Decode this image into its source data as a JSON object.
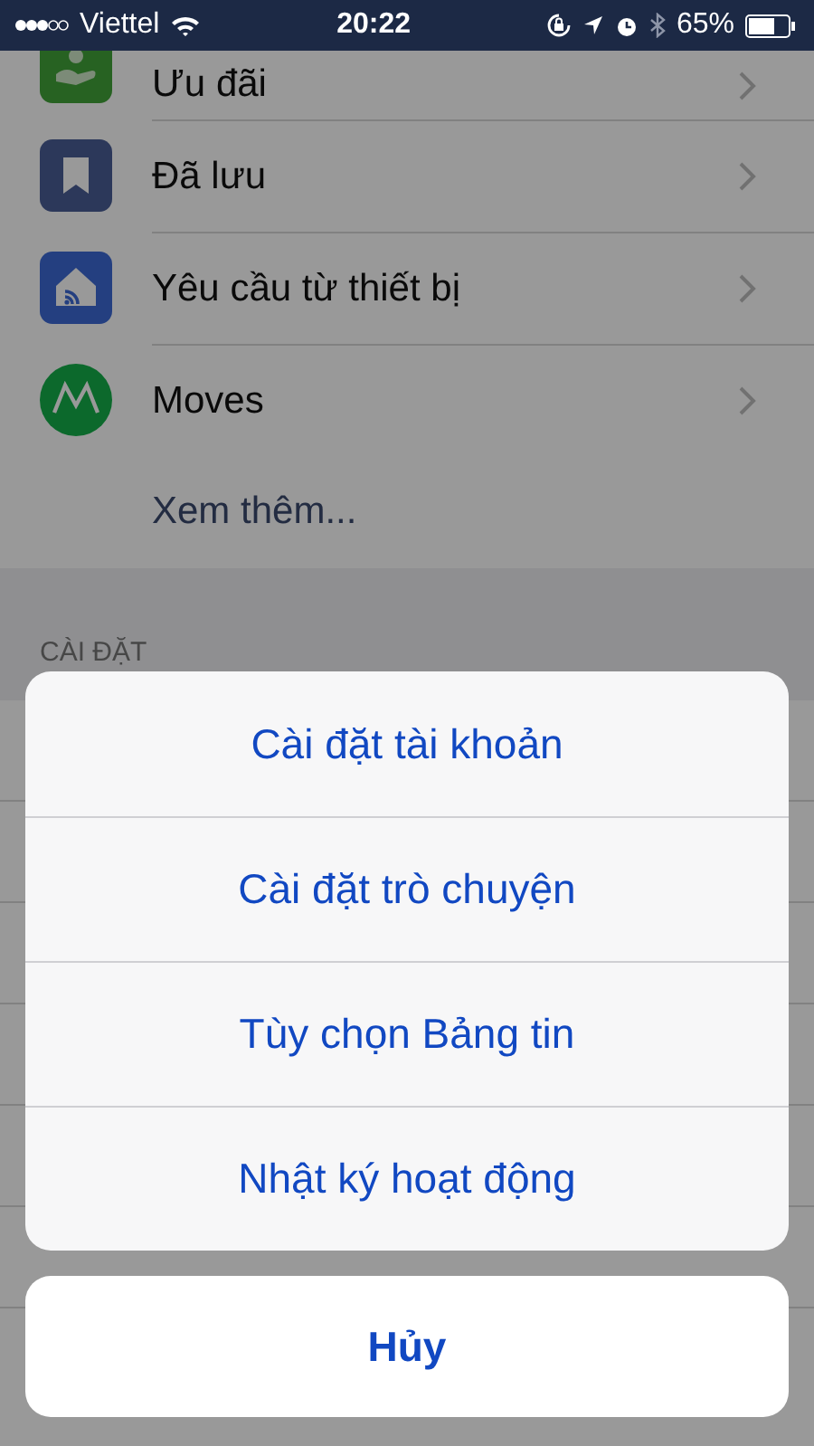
{
  "status_bar": {
    "carrier": "Viettel",
    "time": "20:22",
    "battery": "65%"
  },
  "menu_items": [
    {
      "label": "Ưu đãi",
      "kind": "offers"
    },
    {
      "label": "Đã lưu",
      "kind": "saved"
    },
    {
      "label": "Yêu cầu từ thiết bị",
      "kind": "device"
    },
    {
      "label": "Moves",
      "kind": "moves"
    }
  ],
  "see_more": "Xem thêm...",
  "section_header": "CÀI ĐẶT",
  "action_sheet": {
    "actions": [
      "Cài đặt tài khoản",
      "Cài đặt trò chuyện",
      "Tùy chọn Bảng tin",
      "Nhật ký hoạt động"
    ],
    "cancel": "Hủy"
  }
}
